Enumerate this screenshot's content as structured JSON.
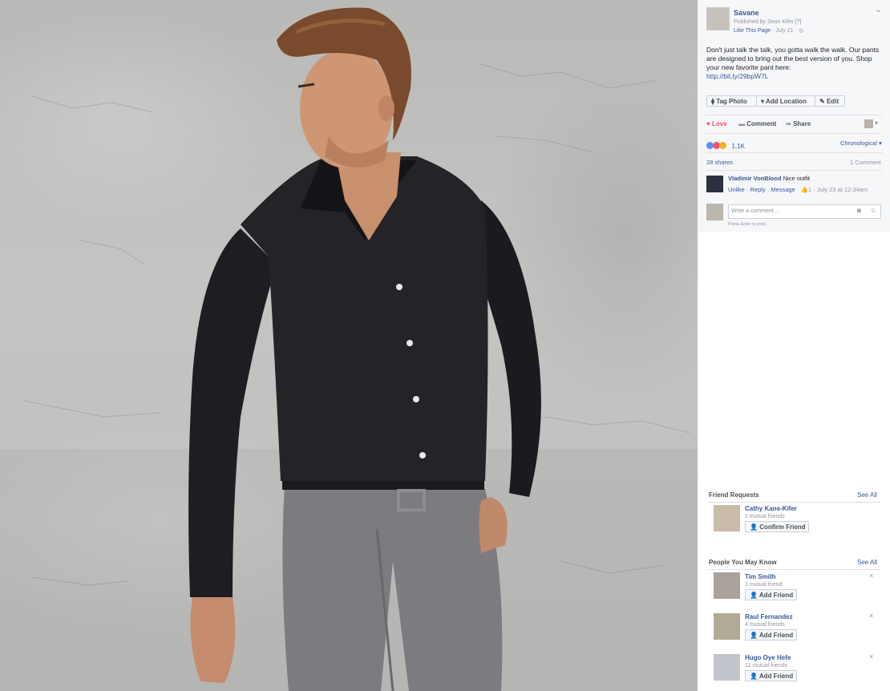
{
  "post": {
    "page_name": "Savane",
    "published_by": "Published by Sean Kifer",
    "help_mark": "[?]",
    "like_page": "Like This Page",
    "date": "· July 21 ·",
    "text": "Don't just talk the talk, you gotta walk the walk. Our pants are designed to bring out the best version of you. Shop your new favorite pant here:",
    "link": "http://bit.ly/29bpW7L",
    "tag_photo": "Tag Photo",
    "add_location": "Add Location",
    "edit": "Edit",
    "love": "Love",
    "comment": "Comment",
    "share": "Share",
    "reaction_count": "1.1K",
    "sort": "Chronological",
    "shares": "28 shares",
    "comments_count": "1 Comment",
    "comment_author": "Vladimir VonBlood",
    "comment_text": "Nice outfit",
    "unlike": "Unlike",
    "reply": "Reply",
    "message": "Message",
    "comment_likes": "1",
    "comment_time": "· July 23 at 12:34am",
    "write_placeholder": "Write a comment...",
    "press_enter": "Press Enter to post."
  },
  "friend_requests": {
    "title": "Friend Requests",
    "see_all": "See All",
    "items": [
      {
        "name": "Cathy Kane-Kifer",
        "mutual": "2 mutual friends",
        "action": "Confirm Friend"
      }
    ]
  },
  "people_you_may_know": {
    "title": "People You May Know",
    "see_all": "See All",
    "items": [
      {
        "name": "Tim Smith",
        "mutual": "1 mutual friend",
        "action": "Add Friend"
      },
      {
        "name": "Raul Fernandez",
        "mutual": "4 mutual friends",
        "action": "Add Friend"
      },
      {
        "name": "Hugo Oye Hefe",
        "mutual": "11 mutual friends",
        "action": "Add Friend"
      }
    ]
  },
  "icons": {
    "close": "×",
    "chevron": "⌄"
  },
  "colors": {
    "link": "#365899",
    "love": "#f25268",
    "muted": "#90949c"
  }
}
